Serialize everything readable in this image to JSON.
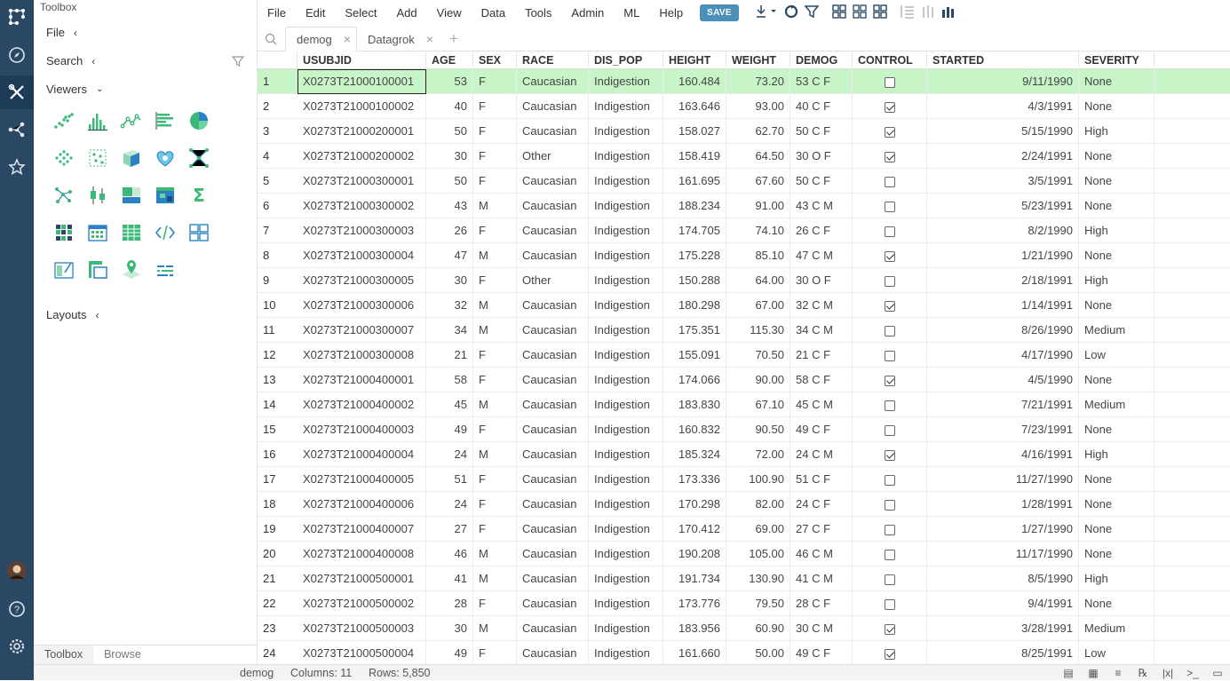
{
  "toolbox": {
    "title": "Toolbox",
    "sections": {
      "file": "File",
      "search": "Search",
      "viewers": "Viewers",
      "layouts": "Layouts"
    },
    "tabs": {
      "toolbox": "Toolbox",
      "browse": "Browse"
    }
  },
  "menu": [
    "File",
    "Edit",
    "Select",
    "Add",
    "View",
    "Data",
    "Tools",
    "Admin",
    "ML",
    "Help"
  ],
  "save_label": "SAVE",
  "tabs": {
    "demog": "demog",
    "datagrok": "Datagrok"
  },
  "colors": {
    "rail": "#2a4763",
    "current_row": "#c8f5c8",
    "save": "#4a90b8",
    "viewer_icon": "#3cb878"
  },
  "grid": {
    "columns": [
      "USUBJID",
      "AGE",
      "SEX",
      "RACE",
      "DIS_POP",
      "HEIGHT",
      "WEIGHT",
      "DEMOG",
      "CONTROL",
      "STARTED",
      "SEVERITY"
    ],
    "rows": [
      [
        "1",
        "X0273T21000100001",
        "53",
        "F",
        "Caucasian",
        "Indigestion",
        "160.484",
        "73.20",
        "53 C F",
        false,
        "9/11/1990",
        "None"
      ],
      [
        "2",
        "X0273T21000100002",
        "40",
        "F",
        "Caucasian",
        "Indigestion",
        "163.646",
        "93.00",
        "40 C F",
        true,
        "4/3/1991",
        "None"
      ],
      [
        "3",
        "X0273T21000200001",
        "50",
        "F",
        "Caucasian",
        "Indigestion",
        "158.027",
        "62.70",
        "50 C F",
        true,
        "5/15/1990",
        "High"
      ],
      [
        "4",
        "X0273T21000200002",
        "30",
        "F",
        "Other",
        "Indigestion",
        "158.419",
        "64.50",
        "30 O F",
        true,
        "2/24/1991",
        "None"
      ],
      [
        "5",
        "X0273T21000300001",
        "50",
        "F",
        "Caucasian",
        "Indigestion",
        "161.695",
        "67.60",
        "50 C F",
        false,
        "3/5/1991",
        "None"
      ],
      [
        "6",
        "X0273T21000300002",
        "43",
        "M",
        "Caucasian",
        "Indigestion",
        "188.234",
        "91.00",
        "43 C M",
        false,
        "5/23/1991",
        "None"
      ],
      [
        "7",
        "X0273T21000300003",
        "26",
        "F",
        "Caucasian",
        "Indigestion",
        "174.705",
        "74.10",
        "26 C F",
        false,
        "8/2/1990",
        "High"
      ],
      [
        "8",
        "X0273T21000300004",
        "47",
        "M",
        "Caucasian",
        "Indigestion",
        "175.228",
        "85.10",
        "47 C M",
        true,
        "1/21/1990",
        "None"
      ],
      [
        "9",
        "X0273T21000300005",
        "30",
        "F",
        "Other",
        "Indigestion",
        "150.288",
        "64.00",
        "30 O F",
        false,
        "2/18/1991",
        "High"
      ],
      [
        "10",
        "X0273T21000300006",
        "32",
        "M",
        "Caucasian",
        "Indigestion",
        "180.298",
        "67.00",
        "32 C M",
        true,
        "1/14/1991",
        "None"
      ],
      [
        "11",
        "X0273T21000300007",
        "34",
        "M",
        "Caucasian",
        "Indigestion",
        "175.351",
        "115.30",
        "34 C M",
        false,
        "8/26/1990",
        "Medium"
      ],
      [
        "12",
        "X0273T21000300008",
        "21",
        "F",
        "Caucasian",
        "Indigestion",
        "155.091",
        "70.50",
        "21 C F",
        false,
        "4/17/1990",
        "Low"
      ],
      [
        "13",
        "X0273T21000400001",
        "58",
        "F",
        "Caucasian",
        "Indigestion",
        "174.066",
        "90.00",
        "58 C F",
        true,
        "4/5/1990",
        "None"
      ],
      [
        "14",
        "X0273T21000400002",
        "45",
        "M",
        "Caucasian",
        "Indigestion",
        "183.830",
        "67.10",
        "45 C M",
        false,
        "7/21/1991",
        "Medium"
      ],
      [
        "15",
        "X0273T21000400003",
        "49",
        "F",
        "Caucasian",
        "Indigestion",
        "160.832",
        "90.50",
        "49 C F",
        false,
        "7/23/1991",
        "None"
      ],
      [
        "16",
        "X0273T21000400004",
        "24",
        "M",
        "Caucasian",
        "Indigestion",
        "185.324",
        "72.00",
        "24 C M",
        true,
        "4/16/1991",
        "High"
      ],
      [
        "17",
        "X0273T21000400005",
        "51",
        "F",
        "Caucasian",
        "Indigestion",
        "173.336",
        "100.90",
        "51 C F",
        false,
        "11/27/1990",
        "None"
      ],
      [
        "18",
        "X0273T21000400006",
        "24",
        "F",
        "Caucasian",
        "Indigestion",
        "170.298",
        "82.00",
        "24 C F",
        false,
        "1/28/1991",
        "None"
      ],
      [
        "19",
        "X0273T21000400007",
        "27",
        "F",
        "Caucasian",
        "Indigestion",
        "170.412",
        "69.00",
        "27 C F",
        false,
        "1/27/1990",
        "None"
      ],
      [
        "20",
        "X0273T21000400008",
        "46",
        "M",
        "Caucasian",
        "Indigestion",
        "190.208",
        "105.00",
        "46 C M",
        false,
        "11/17/1990",
        "None"
      ],
      [
        "21",
        "X0273T21000500001",
        "41",
        "M",
        "Caucasian",
        "Indigestion",
        "191.734",
        "130.90",
        "41 C M",
        false,
        "8/5/1990",
        "High"
      ],
      [
        "22",
        "X0273T21000500002",
        "28",
        "F",
        "Caucasian",
        "Indigestion",
        "173.776",
        "79.50",
        "28 C F",
        false,
        "9/4/1991",
        "None"
      ],
      [
        "23",
        "X0273T21000500003",
        "30",
        "M",
        "Caucasian",
        "Indigestion",
        "183.956",
        "60.90",
        "30 C M",
        true,
        "3/28/1991",
        "Medium"
      ],
      [
        "24",
        "X0273T21000500004",
        "49",
        "F",
        "Caucasian",
        "Indigestion",
        "161.660",
        "50.00",
        "49 C F",
        true,
        "8/25/1991",
        "Low"
      ]
    ]
  },
  "status": {
    "table": "demog",
    "columns": "Columns: 11",
    "rows": "Rows: 5,850"
  }
}
